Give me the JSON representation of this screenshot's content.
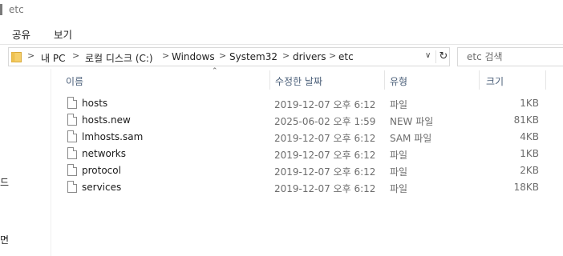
{
  "window": {
    "title": "etc"
  },
  "ribbon": {
    "tabs": [
      {
        "label": "공유"
      },
      {
        "label": "보기"
      }
    ]
  },
  "address": {
    "crumbs": [
      {
        "label": "내 PC"
      },
      {
        "label": "로컬 디스크 (C:)"
      },
      {
        "label": "Windows"
      },
      {
        "label": "System32"
      },
      {
        "label": "drivers"
      },
      {
        "label": "etc"
      }
    ],
    "separator": ">"
  },
  "search": {
    "placeholder": "etc 검색"
  },
  "navpane": {
    "fragments": [
      {
        "label": "드"
      },
      {
        "label": "면"
      }
    ]
  },
  "columns": {
    "name": "이름",
    "date": "수정한 날짜",
    "type": "유형",
    "size": "크기"
  },
  "files": [
    {
      "name": "hosts",
      "date": "2019-12-07 오후 6:12",
      "type": "파일",
      "size": "1KB"
    },
    {
      "name": "hosts.new",
      "date": "2025-06-02 오후 1:59",
      "type": "NEW 파일",
      "size": "81KB"
    },
    {
      "name": "lmhosts.sam",
      "date": "2019-12-07 오후 6:12",
      "type": "SAM 파일",
      "size": "4KB"
    },
    {
      "name": "networks",
      "date": "2019-12-07 오후 6:12",
      "type": "파일",
      "size": "1KB"
    },
    {
      "name": "protocol",
      "date": "2019-12-07 오후 6:12",
      "type": "파일",
      "size": "2KB"
    },
    {
      "name": "services",
      "date": "2019-12-07 오후 6:12",
      "type": "파일",
      "size": "18KB"
    }
  ]
}
